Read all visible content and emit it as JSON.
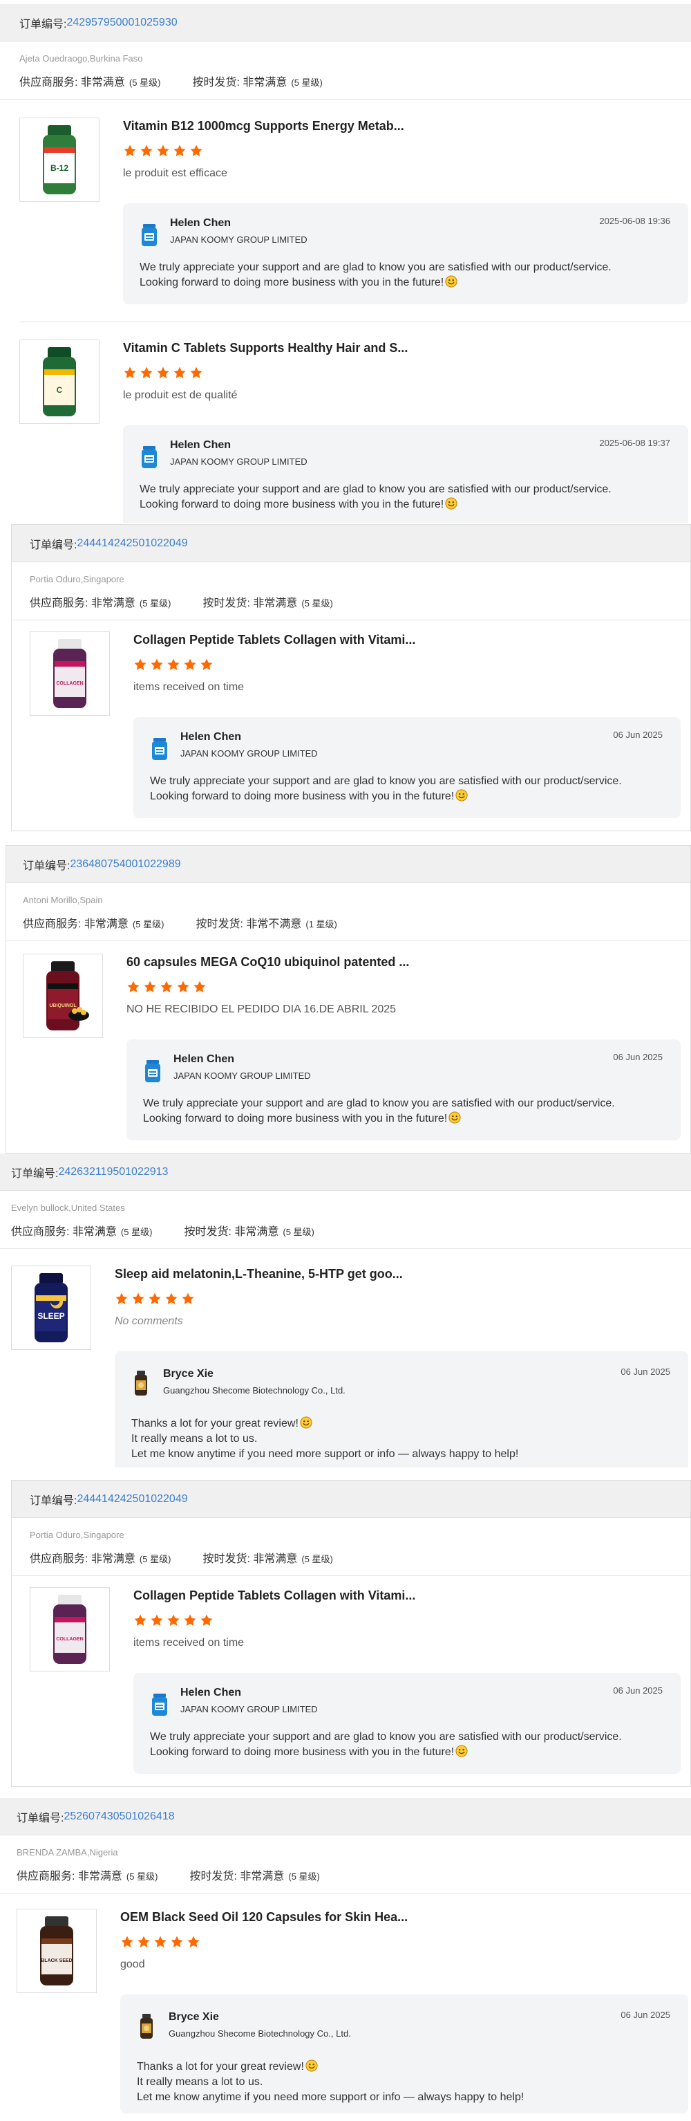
{
  "labels": {
    "order_no": "订单编号:",
    "supplier_service": "供应商服务:",
    "on_time_delivery": "按时发货:"
  },
  "colors": {
    "star": "#ff6a00",
    "link": "#3a7fd0"
  },
  "orders": [
    {
      "order_id": "242957950001025930",
      "buyer": "Ajeta Ouedraogo,Burkina Faso",
      "supplier_rating": "非常满意",
      "supplier_level": "(5 星级)",
      "delivery_rating": "非常满意",
      "delivery_level": "(5 星级)",
      "items": [
        {
          "product_icon": "b12-bottle-icon",
          "title": "Vitamin B12 1000mcg Supports Energy Metab...",
          "stars": 5,
          "comment": "le produit est efficace",
          "reply": {
            "name": "Helen Chen",
            "company": "JAPAN KOOMY GROUP LIMITED",
            "date": "2025-06-08 19:36",
            "lines": [
              "We truly appreciate your support and are glad to know you are satisfied with our product/service.",
              "Looking forward to doing more business with you in the future!"
            ]
          }
        },
        {
          "product_icon": "vitamin-c-bottle-icon",
          "title": "Vitamin C Tablets Supports Healthy Hair and S...",
          "stars": 5,
          "comment": "le produit est de qualité",
          "reply": {
            "name": "Helen Chen",
            "company": "JAPAN KOOMY GROUP LIMITED",
            "date": "2025-06-08 19:37",
            "lines": [
              "We truly appreciate your support and are glad to know you are satisfied with our product/service.",
              "Looking forward to doing more business with you in the future!"
            ]
          }
        }
      ]
    },
    {
      "order_id": "244414242501022049",
      "buyer": "Portia Oduro,Singapore",
      "supplier_rating": "非常满意",
      "supplier_level": "(5 星级)",
      "delivery_rating": "非常满意",
      "delivery_level": "(5 星级)",
      "items": [
        {
          "product_icon": "collagen-bottle-icon",
          "title": "Collagen Peptide Tablets Collagen with Vitami...",
          "stars": 5,
          "comment": "items received on time",
          "reply": {
            "name": "Helen Chen",
            "company": "JAPAN KOOMY GROUP LIMITED",
            "date": "06 Jun 2025",
            "lines": [
              "We truly appreciate your support and are glad to know you are satisfied with our product/service.",
              "Looking forward to doing more business with you in the future!"
            ]
          }
        }
      ]
    },
    {
      "order_id": "236480754001022989",
      "buyer": "Antoni Morillo,Spain",
      "supplier_rating": "非常满意",
      "supplier_level": "(5 星级)",
      "delivery_rating": "非常不满意",
      "delivery_level": "(1 星级)",
      "items": [
        {
          "product_icon": "ubiquinol-bottle-icon",
          "title": "60 capsules MEGA CoQ10 ubiquinol patented ...",
          "stars": 5,
          "comment": "NO HE RECIBIDO EL PEDIDO DIA 16.DE ABRIL 2025",
          "reply": {
            "name": "Helen Chen",
            "company": "JAPAN KOOMY GROUP LIMITED",
            "date": "06 Jun 2025",
            "lines": [
              "We truly appreciate your support and are glad to know you are satisfied with our product/service.",
              "Looking forward to doing more business with you in the future!"
            ]
          }
        }
      ]
    },
    {
      "order_id": "242632119501022913",
      "buyer": "Evelyn bullock,United States",
      "supplier_rating": "非常满意",
      "supplier_level": "(5 星级)",
      "delivery_rating": "非常满意",
      "delivery_level": "(5 星级)",
      "items": [
        {
          "product_icon": "sleep-bottle-icon",
          "title": "Sleep aid melatonin,L-Theanine, 5-HTP get goo...",
          "stars": 5,
          "comment": "No comments",
          "reply": {
            "name": "Bryce Xie",
            "company": "Guangzhou Shecome Biotechnology Co., Ltd.",
            "date": "06 Jun 2025",
            "lines": [
              "Thanks a lot for your great review!",
              "It really means a lot to us.",
              "Let me know anytime if you need more support or info — always happy to help!"
            ]
          }
        }
      ]
    },
    {
      "order_id": "244414242501022049",
      "buyer": "Portia Oduro,Singapore",
      "supplier_rating": "非常满意",
      "supplier_level": "(5 星级)",
      "delivery_rating": "非常满意",
      "delivery_level": "(5 星级)",
      "items": [
        {
          "product_icon": "collagen-bottle-icon",
          "title": "Collagen Peptide Tablets Collagen with Vitami...",
          "stars": 5,
          "comment": "items received on time",
          "reply": {
            "name": "Helen Chen",
            "company": "JAPAN KOOMY GROUP LIMITED",
            "date": "06 Jun 2025",
            "lines": [
              "We truly appreciate your support and are glad to know you are satisfied with our product/service.",
              "Looking forward to doing more business with you in the future!"
            ]
          }
        }
      ]
    },
    {
      "order_id": "252607430501026418",
      "buyer": "BRENDA ZAMBA,Nigeria",
      "supplier_rating": "非常满意",
      "supplier_level": "(5 星级)",
      "delivery_rating": "非常满意",
      "delivery_level": "(5 星级)",
      "items": [
        {
          "product_icon": "black-seed-oil-bottle-icon",
          "title": "OEM Black Seed Oil 120 Capsules for Skin Hea...",
          "stars": 5,
          "comment": "good",
          "reply": {
            "name": "Bryce Xie",
            "company": "Guangzhou Shecome Biotechnology Co., Ltd.",
            "date": "06 Jun 2025",
            "lines": [
              "Thanks a lot for your great review!",
              "It really means a lot to us.",
              "Let me know anytime if you need more support or info — always happy to help!"
            ]
          }
        }
      ]
    }
  ]
}
